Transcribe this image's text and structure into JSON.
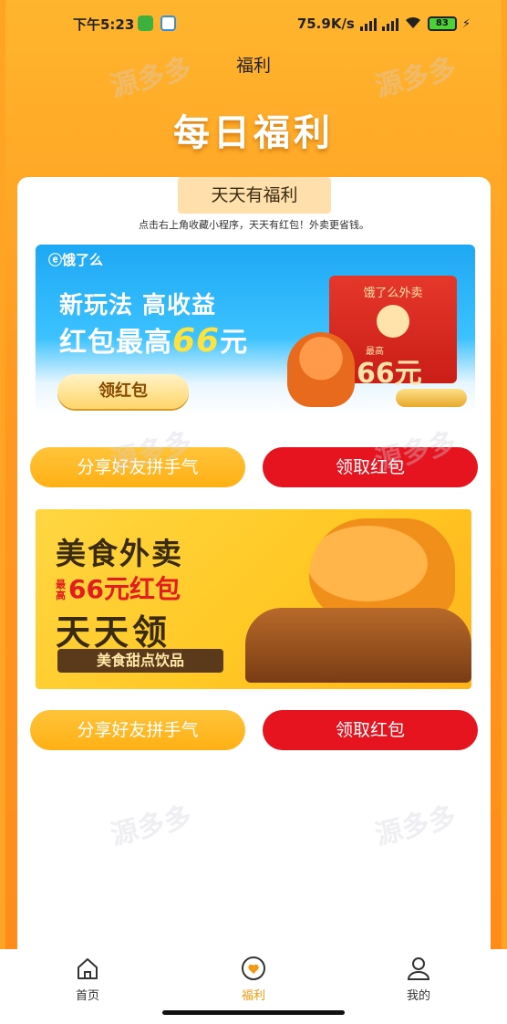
{
  "status_bar": {
    "time": "下午5:23",
    "network_speed": "75.9K/s",
    "battery": "83"
  },
  "nav": {
    "title": "福利"
  },
  "hero": {
    "title": "每日福利"
  },
  "card": {
    "tab_label": "天天有福利",
    "hint": "点击右上角收藏小程序，天天有红包！外卖更省钱。",
    "banner1": {
      "logo": "ⓔ饿了么",
      "line1": "新玩法 高收益",
      "line2_prefix": "红包最高",
      "line2_amount": "66",
      "line2_unit": "元",
      "button_label": "领红包",
      "envelope_title": "饿了么外卖",
      "envelope_small": "最高",
      "envelope_amount": "66元"
    },
    "row1": {
      "share_label": "分享好友拼手气",
      "get_label": "领取红包"
    },
    "banner2": {
      "title": "美食外卖",
      "sub_tag": "最高",
      "sub": "66元红包",
      "daily": "天天领",
      "bar": "美食甜点饮品"
    },
    "row2": {
      "share_label": "分享好友拼手气",
      "get_label": "领取红包"
    }
  },
  "tab_bar": {
    "items": [
      {
        "label": "首页",
        "icon": "home-icon"
      },
      {
        "label": "福利",
        "icon": "heart-icon"
      },
      {
        "label": "我的",
        "icon": "user-icon"
      }
    ],
    "active": "福利"
  },
  "watermark": "源多多",
  "colors": {
    "header_orange": "#ffa424",
    "share_yellow": "#ffb014",
    "get_red": "#e5141f",
    "active_tab": "#f39a12"
  }
}
